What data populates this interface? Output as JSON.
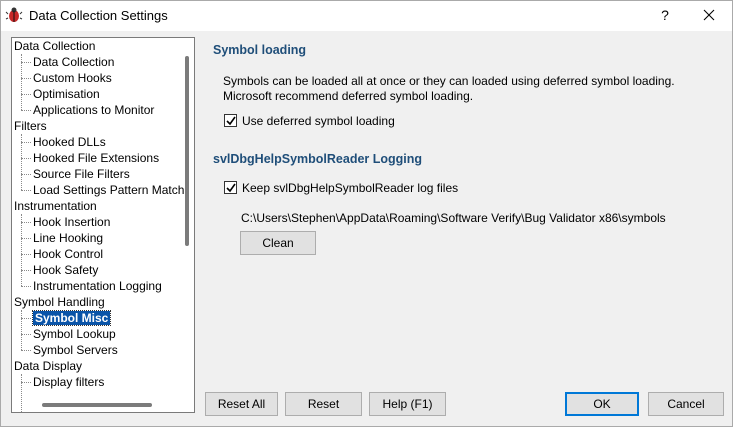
{
  "window": {
    "title": "Data Collection Settings",
    "help_glyph": "?",
    "close_glyph": "✕"
  },
  "tree": {
    "categories": [
      {
        "label": "Data Collection",
        "children": [
          "Data Collection",
          "Custom Hooks",
          "Optimisation",
          "Applications to Monitor"
        ]
      },
      {
        "label": "Filters",
        "children": [
          "Hooked DLLs",
          "Hooked File Extensions",
          "Source File Filters",
          "Load Settings Pattern Match"
        ]
      },
      {
        "label": "Instrumentation",
        "children": [
          "Hook Insertion",
          "Line Hooking",
          "Hook Control",
          "Hook Safety",
          "Instrumentation Logging"
        ]
      },
      {
        "label": "Symbol Handling",
        "children": [
          "Symbol Misc",
          "Symbol Lookup",
          "Symbol Servers"
        ]
      },
      {
        "label": "Data Display",
        "children": [
          "Display filters"
        ]
      }
    ],
    "selected": "Symbol Misc"
  },
  "symbol_loading": {
    "title": "Symbol loading",
    "line1": "Symbols can be loaded all at once or they can loaded using deferred symbol loading.",
    "line2": "Microsoft recommend deferred symbol loading.",
    "deferred_label": "Use deferred symbol loading",
    "deferred_checked": true
  },
  "logging": {
    "title": "svlDbgHelpSymbolReader Logging",
    "keep_label": "Keep svlDbgHelpSymbolReader log files",
    "keep_checked": true,
    "path": "C:\\Users\\Stephen\\AppData\\Roaming\\Software Verify\\Bug Validator x86\\symbols",
    "clean_label": "Clean"
  },
  "footer": {
    "reset_all": "Reset All",
    "reset": "Reset",
    "help": "Help (F1)",
    "ok": "OK",
    "cancel": "Cancel"
  }
}
